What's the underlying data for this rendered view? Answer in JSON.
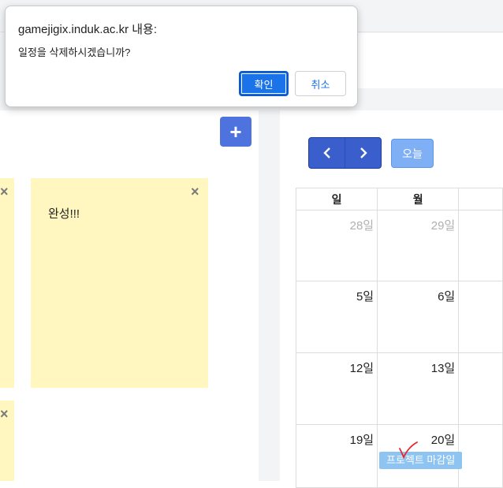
{
  "dialog": {
    "title": "gamejigix.induk.ac.kr 내용:",
    "message": "일정을 삭제하시겠습니까?",
    "ok_label": "확인",
    "cancel_label": "취소"
  },
  "notes": {
    "add_button_label": "+",
    "close_label": "×",
    "items": [
      {
        "text": ""
      },
      {
        "text": "완성!!!"
      },
      {
        "text": ""
      }
    ]
  },
  "calendar": {
    "nav_prev": "‹",
    "nav_next": "›",
    "today_label": "오늘",
    "headers": [
      "일",
      "월",
      ""
    ],
    "weeks": [
      [
        "28일",
        "29일",
        ""
      ],
      [
        "5일",
        "6일",
        ""
      ],
      [
        "12일",
        "13일",
        ""
      ],
      [
        "19일",
        "20일",
        ""
      ]
    ],
    "event_label": "프로젝트 마감일"
  },
  "colors": {
    "primary": "#4e73df",
    "note_bg": "#fff7bf",
    "event_bg": "#8ec4f2",
    "dialog_ok": "#1a73e8"
  }
}
